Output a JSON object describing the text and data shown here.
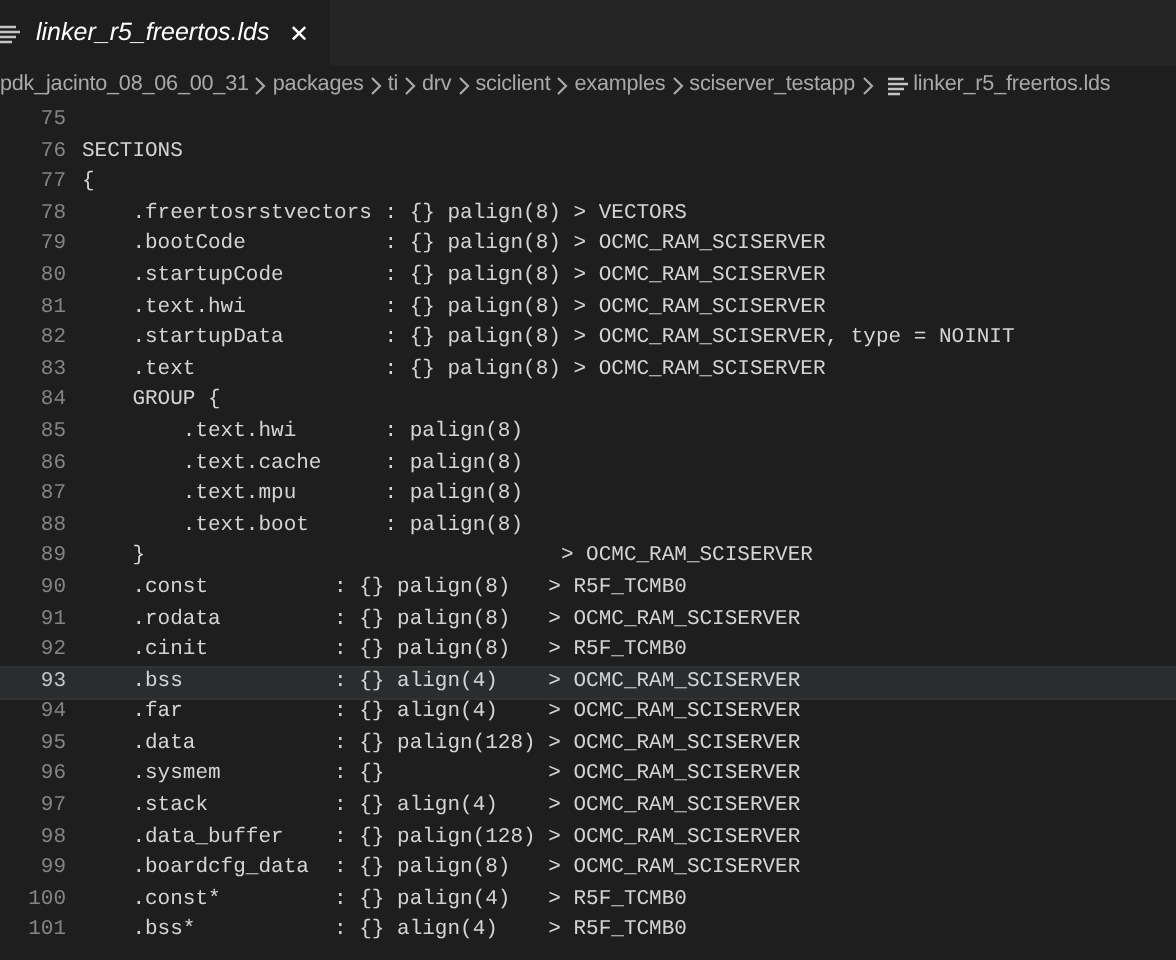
{
  "tab": {
    "label": "linker_r5_freertos.lds",
    "preview": true,
    "close": "✕"
  },
  "breadcrumb": [
    {
      "label": "pdk_jacinto_08_06_00_31",
      "kind": "folder"
    },
    {
      "label": "packages",
      "kind": "folder"
    },
    {
      "label": "ti",
      "kind": "folder"
    },
    {
      "label": "drv",
      "kind": "folder"
    },
    {
      "label": "sciclient",
      "kind": "folder"
    },
    {
      "label": "examples",
      "kind": "folder"
    },
    {
      "label": "sciserver_testapp",
      "kind": "folder"
    },
    {
      "label": "linker_r5_freertos.lds",
      "kind": "file"
    }
  ],
  "lines": [
    {
      "number": "75",
      "current": false
    },
    {
      "number": "76",
      "code": "SECTIONS",
      "current": false
    },
    {
      "number": "77",
      "code": "{",
      "current": false
    },
    {
      "number": "78",
      "code": "    .freertosrstvectors : {} palign(8) > VECTORS",
      "current": false
    },
    {
      "number": "79",
      "code": "    .bootCode           : {} palign(8) > OCMC_RAM_SCISERVER",
      "current": false
    },
    {
      "number": "80",
      "code": "    .startupCode        : {} palign(8) > OCMC_RAM_SCISERVER",
      "current": false
    },
    {
      "number": "81",
      "code": "    .text.hwi           : {} palign(8) > OCMC_RAM_SCISERVER",
      "current": false
    },
    {
      "number": "82",
      "code": "    .startupData        : {} palign(8) > OCMC_RAM_SCISERVER, type = NOINIT",
      "current": false
    },
    {
      "number": "83",
      "code": "    .text               : {} palign(8) > OCMC_RAM_SCISERVER",
      "current": false
    },
    {
      "number": "84",
      "code": "    GROUP {",
      "current": false
    },
    {
      "number": "85",
      "code": "        .text.hwi       : palign(8)",
      "current": false
    },
    {
      "number": "86",
      "code": "        .text.cache     : palign(8)",
      "current": false
    },
    {
      "number": "87",
      "code": "        .text.mpu       : palign(8)",
      "current": false
    },
    {
      "number": "88",
      "code": "        .text.boot      : palign(8)",
      "current": false
    },
    {
      "number": "89",
      "code": "    }                                 > OCMC_RAM_SCISERVER",
      "current": false
    },
    {
      "number": "90",
      "code": "    .const          : {} palign(8)   > R5F_TCMB0",
      "current": false
    },
    {
      "number": "91",
      "code": "    .rodata         : {} palign(8)   > OCMC_RAM_SCISERVER",
      "current": false
    },
    {
      "number": "92",
      "code": "    .cinit          : {} palign(8)   > R5F_TCMB0",
      "current": false
    },
    {
      "number": "93",
      "code": "    .bss            : {} align(4)    > OCMC_RAM_SCISERVER",
      "current": true
    },
    {
      "number": "94",
      "code": "    .far            : {} align(4)    > OCMC_RAM_SCISERVER",
      "current": false
    },
    {
      "number": "95",
      "code": "    .data           : {} palign(128) > OCMC_RAM_SCISERVER",
      "current": false
    },
    {
      "number": "96",
      "code": "    .sysmem         : {}             > OCMC_RAM_SCISERVER",
      "current": false
    },
    {
      "number": "97",
      "code": "    .stack          : {} align(4)    > OCMC_RAM_SCISERVER",
      "current": false
    },
    {
      "number": "98",
      "code": "    .data_buffer    : {} palign(128) > OCMC_RAM_SCISERVER",
      "current": false
    },
    {
      "number": "99",
      "code": "    .boardcfg_data  : {} palign(8)   > OCMC_RAM_SCISERVER",
      "current": false
    },
    {
      "number": "100",
      "code": "    .const*         : {} palign(4)   > R5F_TCMB0",
      "current": false
    },
    {
      "number": "101",
      "code": "    .bss*           : {} align(4)    > R5F_TCMB0",
      "current": false
    }
  ]
}
